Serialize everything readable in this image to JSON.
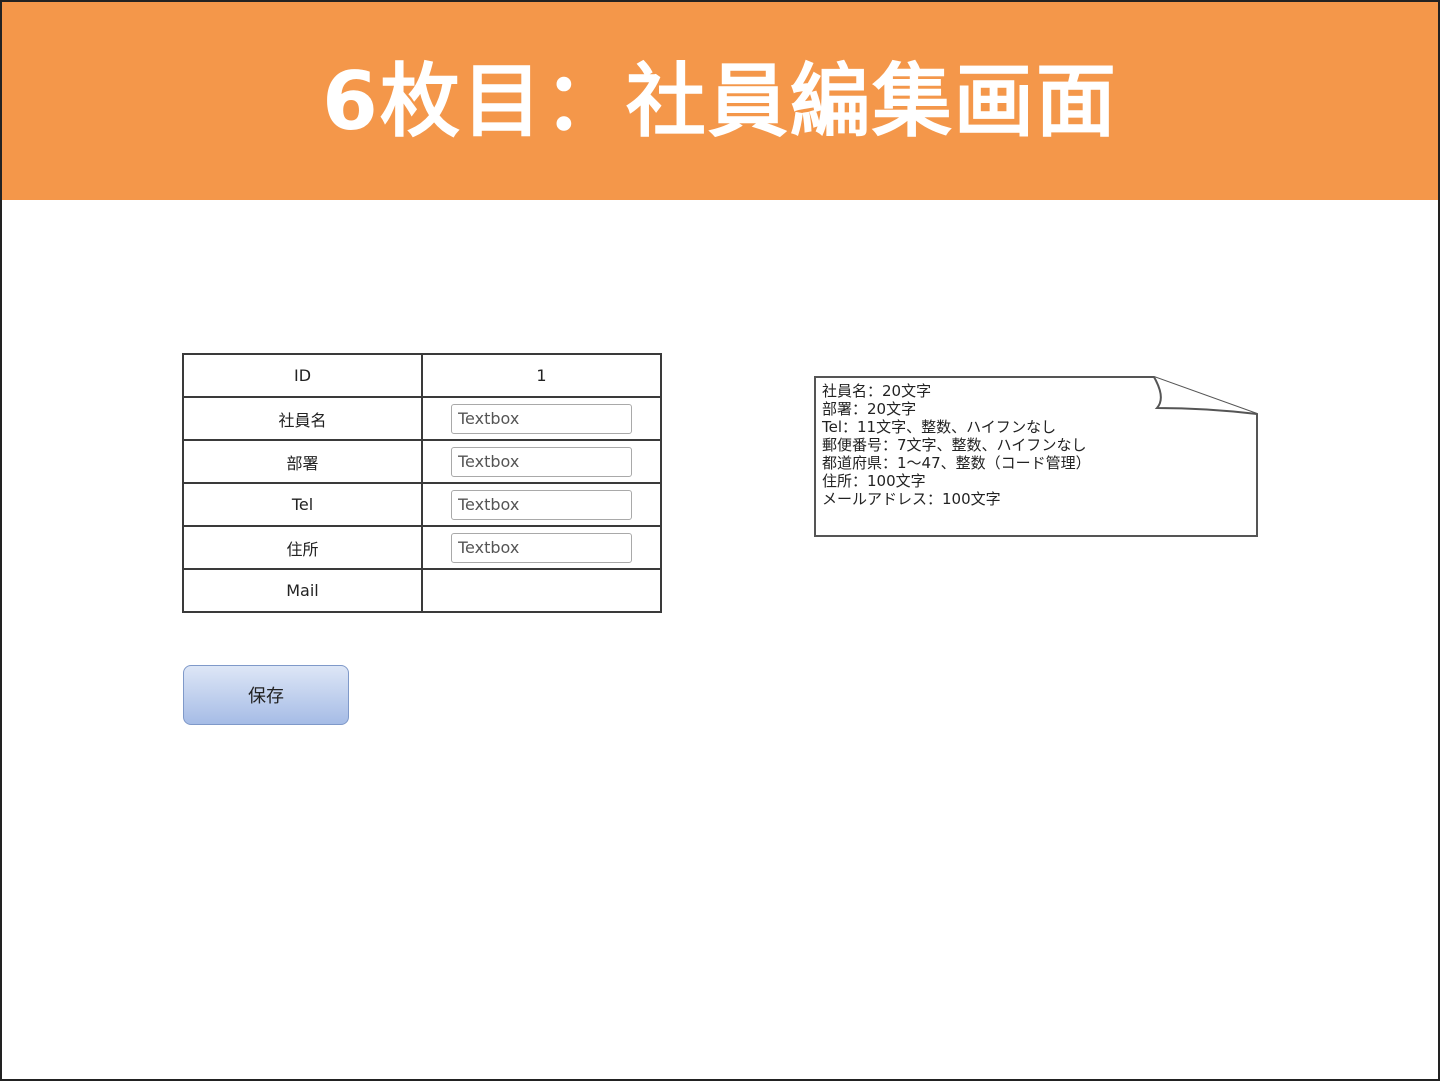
{
  "header": {
    "title": "6枚目：社員編集画面"
  },
  "form": {
    "rows": [
      {
        "label": "ID",
        "value": "1"
      },
      {
        "label": "社員名",
        "placeholder": "Textbox"
      },
      {
        "label": "部署",
        "placeholder": "Textbox"
      },
      {
        "label": "Tel",
        "placeholder": "Textbox"
      },
      {
        "label": "住所",
        "placeholder": "Textbox"
      },
      {
        "label": "Mail",
        "value": ""
      }
    ]
  },
  "actions": {
    "save_label": "保存"
  },
  "note": {
    "lines": [
      "社員名：20文字",
      "部署：20文字",
      "Tel：11文字、整数、ハイフンなし",
      "郵便番号：7文字、整数、ハイフンなし",
      "都道府県：1～47、整数（コード管理）",
      "住所：100文字",
      "メールアドレス：100文字"
    ]
  },
  "colors": {
    "banner": "#f4974a",
    "banner_text": "#ffffff",
    "button_top": "#dde6f6",
    "button_bottom": "#a6bce6"
  }
}
